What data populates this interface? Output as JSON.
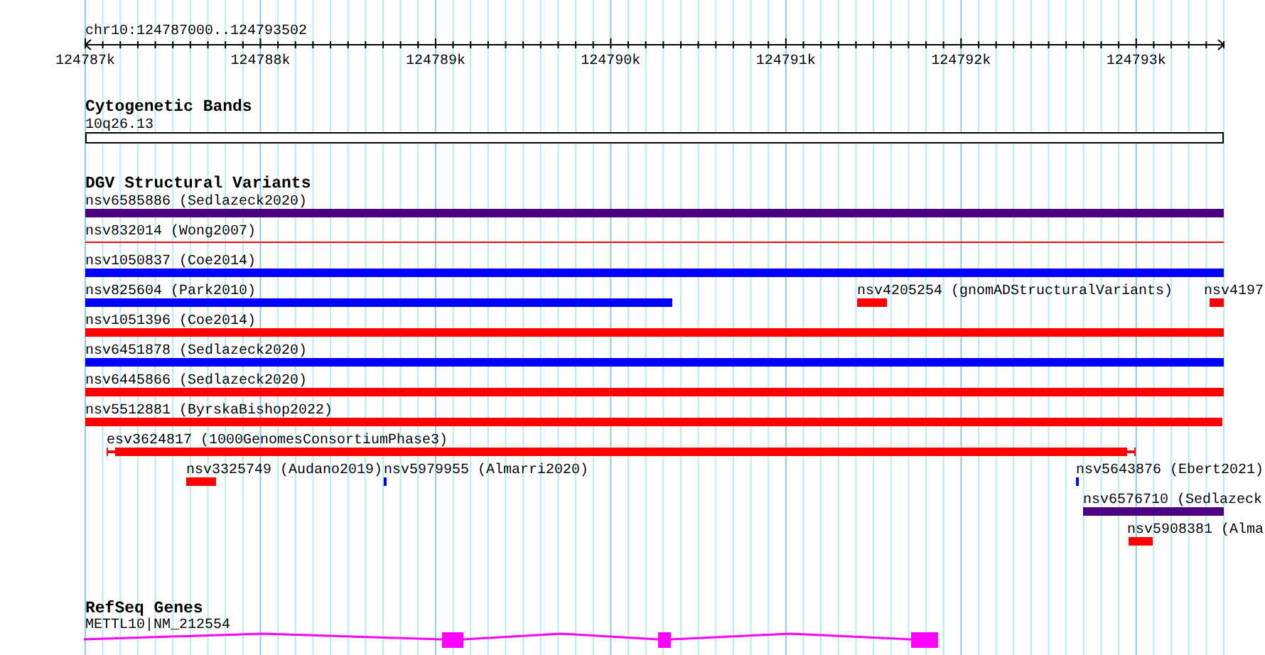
{
  "location": "chr10:124787000..124793502",
  "ruler": {
    "ticks": [
      "124787k",
      "124788k",
      "124789k",
      "124790k",
      "124791k",
      "124792k",
      "124793k"
    ]
  },
  "tracks": [
    {
      "title": "Cytogenetic Bands",
      "features": [
        {
          "label": "10q26.13",
          "kind": "band"
        }
      ]
    },
    {
      "title": "DGV Structural Variants",
      "features": [
        {
          "label": "nsv6585886 (Sedlazeck2020)",
          "kind": "bar",
          "color": "#4b0082"
        },
        {
          "label": "nsv832014 (Wong2007)",
          "kind": "line",
          "color": "#ff0000"
        },
        {
          "label": "nsv1050837 (Coe2014)",
          "kind": "bar",
          "color": "#0000ff"
        },
        {
          "label": "nsv825604 (Park2010)",
          "kind": "bar",
          "color": "#0000ff"
        },
        {
          "label": "nsv4205254 (gnomADStructuralVariants)",
          "kind": "bar",
          "color": "#ff0000"
        },
        {
          "label": "nsv4197",
          "kind": "bar",
          "color": "#ff0000"
        },
        {
          "label": "nsv1051396 (Coe2014)",
          "kind": "bar",
          "color": "#ff0000"
        },
        {
          "label": "nsv6451878 (Sedlazeck2020)",
          "kind": "bar",
          "color": "#0000ff"
        },
        {
          "label": "nsv6445866 (Sedlazeck2020)",
          "kind": "bar",
          "color": "#ff0000"
        },
        {
          "label": "nsv5512881 (ByrskaBishop2022)",
          "kind": "bar",
          "color": "#ff0000"
        },
        {
          "label": "esv3624817 (1000GenomesConsortiumPhase3)",
          "kind": "bracketed",
          "color": "#ff0000"
        },
        {
          "label": "nsv3325749 (Audano2019)",
          "kind": "bar",
          "color": "#ff0000"
        },
        {
          "label": "nsv5979955 (Almarri2020)",
          "kind": "bar",
          "color": "#0000ff"
        },
        {
          "label": "nsv5643876 (Ebert2021)",
          "kind": "bar",
          "color": "#0000ff"
        },
        {
          "label": "nsv6576710 (Sedlazeck",
          "kind": "bar",
          "color": "#4b0082"
        },
        {
          "label": "nsv5908381 (Alma",
          "kind": "bar",
          "color": "#ff0000"
        }
      ]
    },
    {
      "title": "RefSeq Genes",
      "features": [
        {
          "label": "METTL10|NM_212554",
          "kind": "gene",
          "color": "#ff00ff"
        }
      ]
    }
  ]
}
